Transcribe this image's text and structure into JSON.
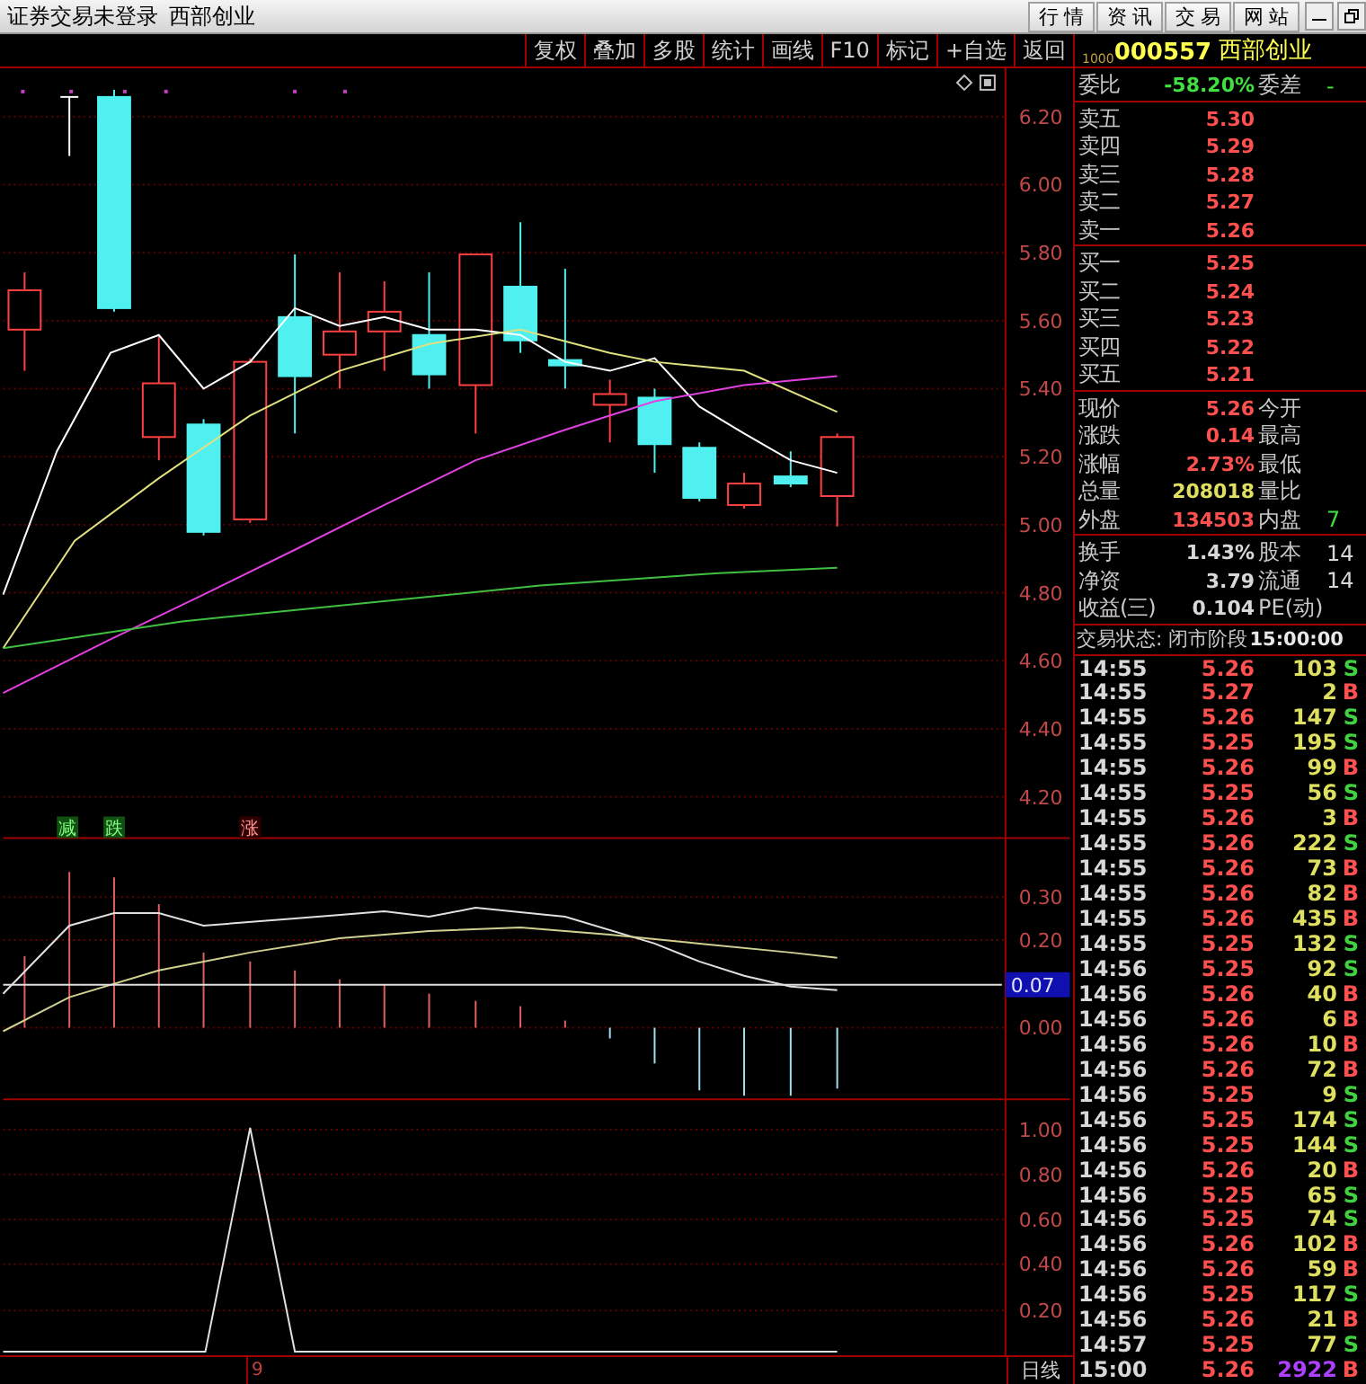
{
  "title_bar": {
    "status": "证券交易未登录",
    "stock": "西部创业",
    "menus": [
      "行情",
      "资讯",
      "交易",
      "网站"
    ]
  },
  "toolbar": [
    "复权",
    "叠加",
    "多股",
    "统计",
    "画线",
    "F10",
    "标记",
    "+自选",
    "返回"
  ],
  "price_pane": {
    "yticks": [
      "6.20",
      "6.00",
      "5.80",
      "5.60",
      "5.40",
      "5.20",
      "5.00",
      "4.80",
      "4.60",
      "4.40",
      "4.20"
    ],
    "signals": [
      {
        "label": "减",
        "kind": "down"
      },
      {
        "label": "跌",
        "kind": "down"
      },
      {
        "label": "涨",
        "kind": "up"
      }
    ]
  },
  "macd_pane": {
    "yticks": [
      "0.30",
      "0.20",
      "0.00"
    ],
    "current": "0.07"
  },
  "indicator_pane": {
    "yticks": [
      "1.00",
      "0.80",
      "0.60",
      "0.40",
      "0.20"
    ]
  },
  "bottom_bar": {
    "date_label": "9",
    "period": "日线"
  },
  "quote": {
    "market": "1000",
    "code": "000557",
    "name": "西部创业",
    "ratio": {
      "label": "委比",
      "value": "-58.20%",
      "color": "#40e040",
      "second": {
        "label": "委差",
        "value": "-",
        "color": "#40e040"
      }
    },
    "sections": [
      [
        {
          "label": "卖五",
          "value": "5.30",
          "color": "#ff5050"
        },
        {
          "label": "卖四",
          "value": "5.29",
          "color": "#ff5050"
        },
        {
          "label": "卖三",
          "value": "5.28",
          "color": "#ff5050"
        },
        {
          "label": "卖二",
          "value": "5.27",
          "color": "#ff5050"
        },
        {
          "label": "卖一",
          "value": "5.26",
          "color": "#ff5050"
        }
      ],
      [
        {
          "label": "买一",
          "value": "5.25",
          "color": "#ff5050"
        },
        {
          "label": "买二",
          "value": "5.24",
          "color": "#ff5050"
        },
        {
          "label": "买三",
          "value": "5.23",
          "color": "#ff5050"
        },
        {
          "label": "买四",
          "value": "5.22",
          "color": "#ff5050"
        },
        {
          "label": "买五",
          "value": "5.21",
          "color": "#ff5050"
        }
      ],
      [
        {
          "label": "现价",
          "value": "5.26",
          "color": "#ff5050",
          "second": {
            "label": "今开"
          }
        },
        {
          "label": "涨跌",
          "value": "0.14",
          "color": "#ff5050",
          "second": {
            "label": "最高"
          }
        },
        {
          "label": "涨幅",
          "value": "2.73%",
          "color": "#ff5050",
          "second": {
            "label": "最低"
          }
        },
        {
          "label": "总量",
          "value": "208018",
          "color": "#e0e060",
          "second": {
            "label": "量比"
          }
        },
        {
          "label": "外盘",
          "value": "134503",
          "color": "#ff5050",
          "second": {
            "label": "内盘",
            "value": "7",
            "color": "#40e040"
          }
        }
      ],
      [
        {
          "label": "换手",
          "value": "1.43%",
          "color": "#d8d8d8",
          "second": {
            "label": "股本",
            "value": "14",
            "color": "#d8d8d8"
          }
        },
        {
          "label": "净资",
          "value": "3.79",
          "color": "#d8d8d8",
          "second": {
            "label": "流通",
            "value": "14",
            "color": "#d8d8d8"
          }
        },
        {
          "label": "收益(三)",
          "value": "0.104",
          "color": "#d8d8d8",
          "second": {
            "label": "PE(动)"
          }
        }
      ]
    ]
  },
  "trade_status": {
    "label": "交易状态: 闭市阶段",
    "time": "15:00:00"
  },
  "ticks": [
    {
      "time": "14:55",
      "price": "5.26",
      "volume": "103",
      "side": "S",
      "color": "#40d040",
      "emphasized": false
    },
    {
      "time": "14:55",
      "price": "5.27",
      "volume": "2",
      "side": "B",
      "color": "#ff5050",
      "emphasized": false
    },
    {
      "time": "14:55",
      "price": "5.26",
      "volume": "147",
      "side": "S",
      "color": "#40d040",
      "emphasized": false
    },
    {
      "time": "14:55",
      "price": "5.25",
      "volume": "195",
      "side": "S",
      "color": "#40d040",
      "emphasized": false
    },
    {
      "time": "14:55",
      "price": "5.26",
      "volume": "99",
      "side": "B",
      "color": "#ff5050",
      "emphasized": false
    },
    {
      "time": "14:55",
      "price": "5.25",
      "volume": "56",
      "side": "S",
      "color": "#40d040",
      "emphasized": false
    },
    {
      "time": "14:55",
      "price": "5.26",
      "volume": "3",
      "side": "B",
      "color": "#ff5050",
      "emphasized": false
    },
    {
      "time": "14:55",
      "price": "5.26",
      "volume": "222",
      "side": "S",
      "color": "#40d040",
      "emphasized": false
    },
    {
      "time": "14:55",
      "price": "5.26",
      "volume": "73",
      "side": "B",
      "color": "#ff5050",
      "emphasized": false
    },
    {
      "time": "14:55",
      "price": "5.26",
      "volume": "82",
      "side": "B",
      "color": "#ff5050",
      "emphasized": false
    },
    {
      "time": "14:55",
      "price": "5.26",
      "volume": "435",
      "side": "B",
      "color": "#ff5050",
      "emphasized": false
    },
    {
      "time": "14:55",
      "price": "5.25",
      "volume": "132",
      "side": "S",
      "color": "#40d040",
      "emphasized": false
    },
    {
      "time": "14:56",
      "price": "5.25",
      "volume": "92",
      "side": "S",
      "color": "#40d040",
      "emphasized": false
    },
    {
      "time": "14:56",
      "price": "5.26",
      "volume": "40",
      "side": "B",
      "color": "#ff5050",
      "emphasized": false
    },
    {
      "time": "14:56",
      "price": "5.26",
      "volume": "6",
      "side": "B",
      "color": "#ff5050",
      "emphasized": false
    },
    {
      "time": "14:56",
      "price": "5.26",
      "volume": "10",
      "side": "B",
      "color": "#ff5050",
      "emphasized": false
    },
    {
      "time": "14:56",
      "price": "5.26",
      "volume": "72",
      "side": "B",
      "color": "#ff5050",
      "emphasized": false
    },
    {
      "time": "14:56",
      "price": "5.25",
      "volume": "9",
      "side": "S",
      "color": "#40d040",
      "emphasized": false
    },
    {
      "time": "14:56",
      "price": "5.25",
      "volume": "174",
      "side": "S",
      "color": "#40d040",
      "emphasized": false
    },
    {
      "time": "14:56",
      "price": "5.25",
      "volume": "144",
      "side": "S",
      "color": "#40d040",
      "emphasized": false
    },
    {
      "time": "14:56",
      "price": "5.26",
      "volume": "20",
      "side": "B",
      "color": "#ff5050",
      "emphasized": false
    },
    {
      "time": "14:56",
      "price": "5.25",
      "volume": "65",
      "side": "S",
      "color": "#40d040",
      "emphasized": false
    },
    {
      "time": "14:56",
      "price": "5.25",
      "volume": "74",
      "side": "S",
      "color": "#40d040",
      "emphasized": false
    },
    {
      "time": "14:56",
      "price": "5.26",
      "volume": "102",
      "side": "B",
      "color": "#ff5050",
      "emphasized": false
    },
    {
      "time": "14:56",
      "price": "5.26",
      "volume": "59",
      "side": "B",
      "color": "#ff5050",
      "emphasized": false
    },
    {
      "time": "14:56",
      "price": "5.25",
      "volume": "117",
      "side": "S",
      "color": "#40d040",
      "emphasized": false
    },
    {
      "time": "14:56",
      "price": "5.26",
      "volume": "21",
      "side": "B",
      "color": "#ff5050",
      "emphasized": false
    },
    {
      "time": "14:57",
      "price": "5.25",
      "volume": "77",
      "side": "S",
      "color": "#40d040",
      "emphasized": false
    },
    {
      "time": "15:00",
      "price": "5.26",
      "volume": "2922",
      "side": "B",
      "color": "#ff5050",
      "emphasized": true
    }
  ]
}
